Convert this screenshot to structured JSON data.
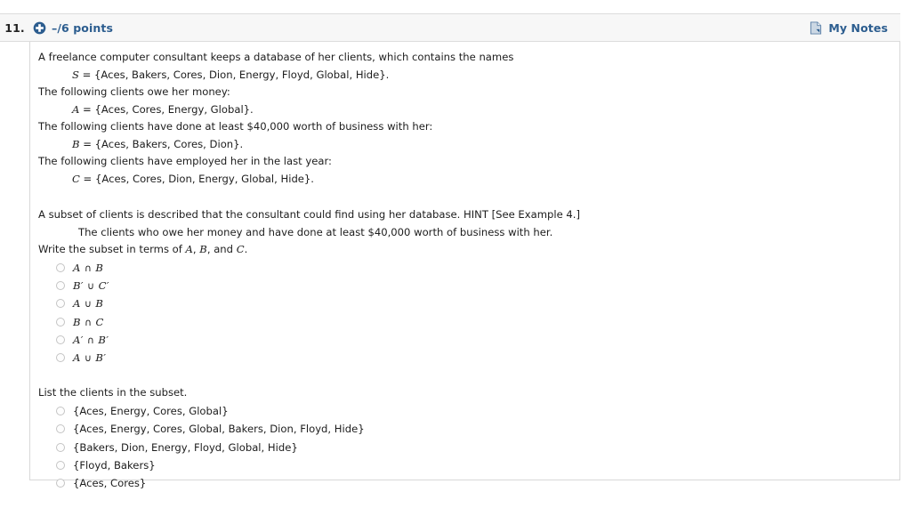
{
  "header": {
    "question_number": "11.",
    "plus_icon": "plus-circle-icon",
    "points": "–/6 points",
    "notes_icon": "document-icon",
    "notes_label": "My Notes",
    "accent_color": "#2c5d8f",
    "bar_background": "#f7f7f7"
  },
  "body": {
    "intro": "A freelance computer consultant keeps a database of her clients, which contains the names",
    "set_s": "S = {Aces, Bakers, Cores, Dion, Energy, Floyd, Global, Hide}.",
    "line_owe": "The following clients owe her money:",
    "set_a": "A = {Aces, Cores, Energy, Global}.",
    "line_business": "The following clients have done at least $40,000 worth of business with her:",
    "set_b": "B = {Aces, Bakers, Cores, Dion}.",
    "line_employed": "The following clients have employed her in the last year:",
    "set_c": "C = {Aces, Cores, Dion, Energy, Global, Hide}.",
    "subset_intro": "A subset of clients is described that the consultant could find using her database. HINT [See Example 4.]",
    "subset_description": "The clients who owe her money and have done at least $40,000 worth of business with her.",
    "prompt_1": "Write the subset in terms of A, B, and C.",
    "prompt_2": "List the clients in the subset."
  },
  "question_1": {
    "options": [
      "A ∩ B",
      "B′ ∪ C′",
      "A ∪ B",
      "B ∩ C",
      "A′ ∩ B′",
      "A ∪ B′"
    ],
    "selected": null
  },
  "question_2": {
    "options": [
      "{Aces, Energy, Cores, Global}",
      "{Aces, Energy, Cores, Global, Bakers, Dion, Floyd, Hide}",
      "{Bakers, Dion, Energy, Floyd, Global, Hide}",
      "{Floyd, Bakers}",
      "{Aces, Cores}"
    ],
    "selected": null
  }
}
